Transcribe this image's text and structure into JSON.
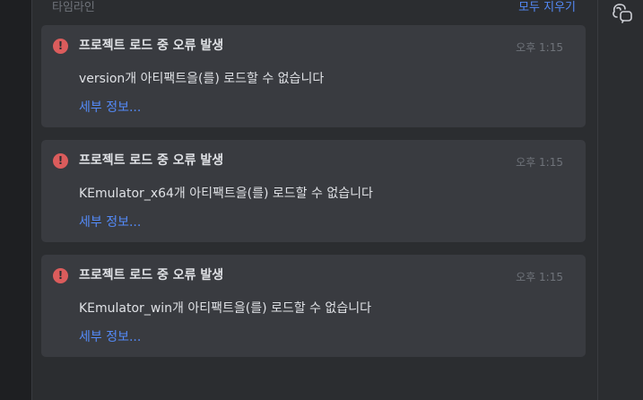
{
  "panel": {
    "title": "타임라인",
    "clear_all": "모두 지우기"
  },
  "notifications": [
    {
      "icon": "error-icon",
      "title": "프로젝트 로드 중 오류 발생",
      "time": "오후 1:15",
      "message": "version개 아티팩트을(를) 로드할 수 없습니다",
      "details": "세부 정보..."
    },
    {
      "icon": "error-icon",
      "title": "프로젝트 로드 중 오류 발생",
      "time": "오후 1:15",
      "message": "KEmulator_x64개 아티팩트을(를) 로드할 수 없습니다",
      "details": "세부 정보..."
    },
    {
      "icon": "error-icon",
      "title": "프로젝트 로드 중 오류 발생",
      "time": "오후 1:15",
      "message": "KEmulator_win개 아티팩트을(를) 로드할 수 없습니다",
      "details": "세부 정보..."
    }
  ],
  "sidebar": {
    "icon": "ai-assistant-icon"
  },
  "colors": {
    "error": "#db5c5c",
    "link": "#548af7",
    "card_bg": "#393b40",
    "panel_bg": "#2b2d30"
  }
}
